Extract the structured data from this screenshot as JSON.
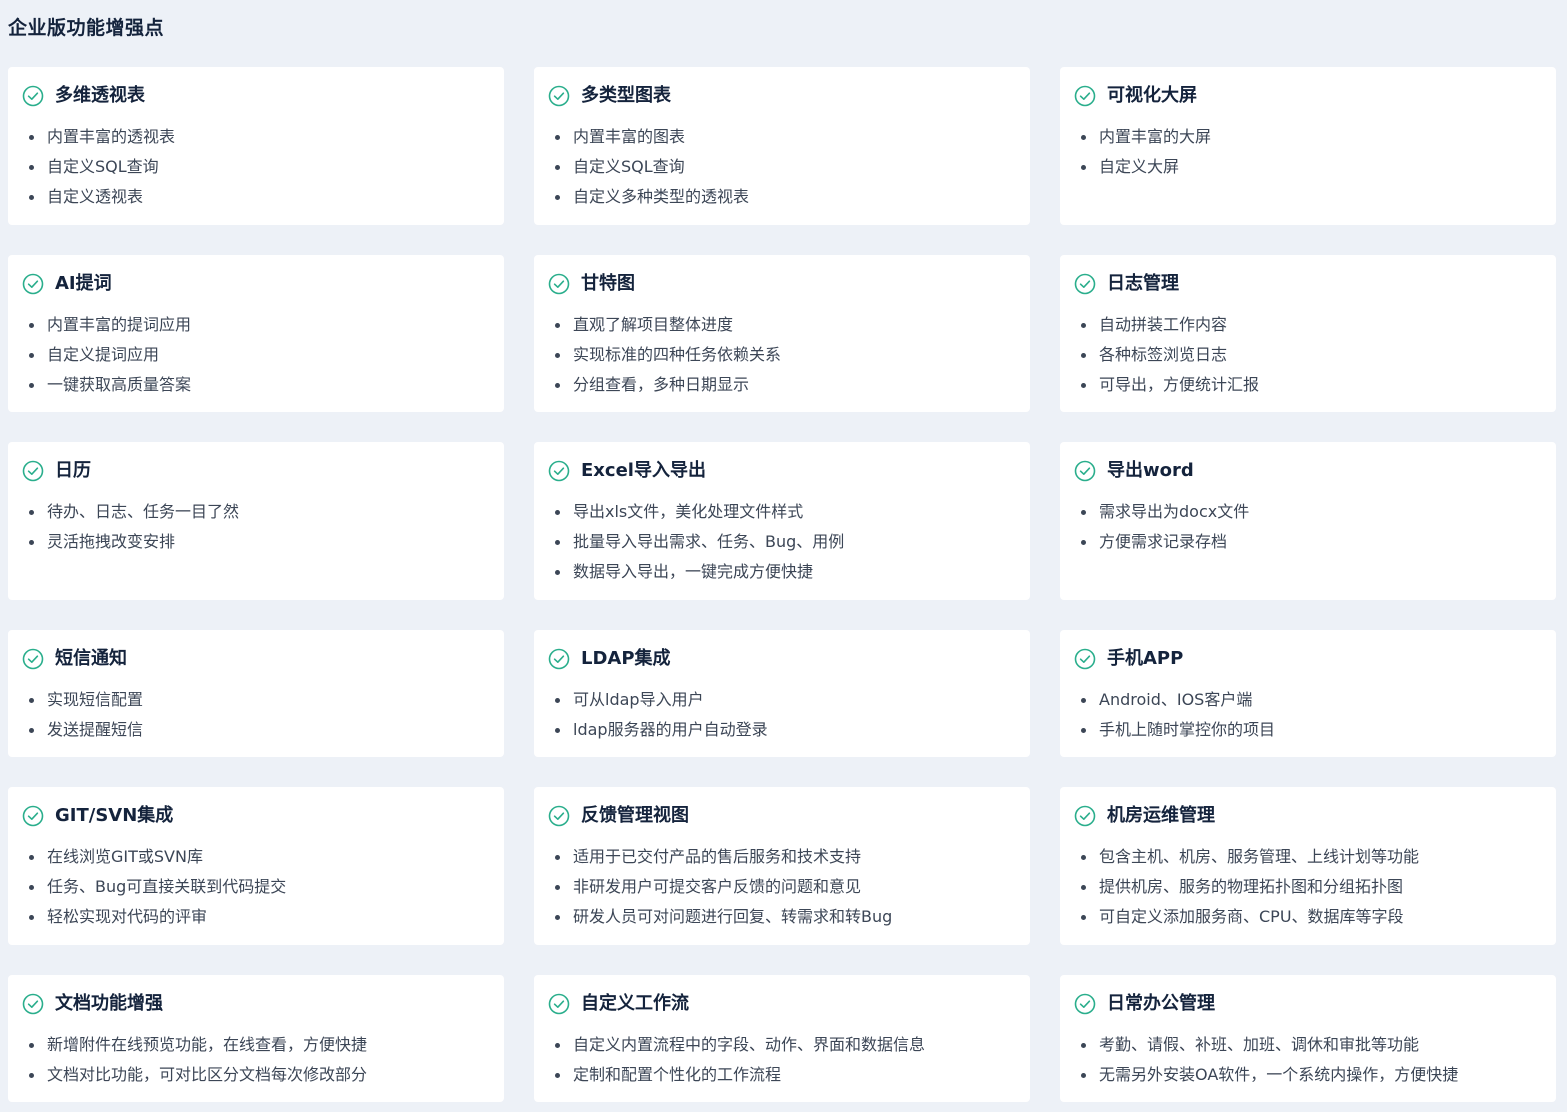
{
  "page_title": "企业版功能增强点",
  "accent_color": "#2aae8c",
  "cards": [
    {
      "title": "多维透视表",
      "icon": "check-circle-icon",
      "items": [
        "内置丰富的透视表",
        "自定义SQL查询",
        "自定义透视表"
      ]
    },
    {
      "title": "多类型图表",
      "icon": "check-circle-icon",
      "items": [
        "内置丰富的图表",
        "自定义SQL查询",
        "自定义多种类型的透视表"
      ]
    },
    {
      "title": "可视化大屏",
      "icon": "check-circle-icon",
      "items": [
        "内置丰富的大屏",
        "自定义大屏"
      ]
    },
    {
      "title": "AI提词",
      "icon": "check-circle-icon",
      "items": [
        "内置丰富的提词应用",
        "自定义提词应用",
        "一键获取高质量答案"
      ]
    },
    {
      "title": "甘特图",
      "icon": "check-circle-icon",
      "items": [
        "直观了解项目整体进度",
        "实现标准的四种任务依赖关系",
        "分组查看，多种日期显示"
      ]
    },
    {
      "title": "日志管理",
      "icon": "check-circle-icon",
      "items": [
        "自动拼装工作内容",
        "各种标签浏览日志",
        "可导出，方便统计汇报"
      ]
    },
    {
      "title": "日历",
      "icon": "check-circle-icon",
      "items": [
        "待办、日志、任务一目了然",
        "灵活拖拽改变安排"
      ]
    },
    {
      "title": "Excel导入导出",
      "icon": "check-circle-icon",
      "items": [
        "导出xls文件，美化处理文件样式",
        "批量导入导出需求、任务、Bug、用例",
        "数据导入导出，一键完成方便快捷"
      ]
    },
    {
      "title": "导出word",
      "icon": "check-circle-icon",
      "items": [
        "需求导出为docx文件",
        "方便需求记录存档"
      ]
    },
    {
      "title": "短信通知",
      "icon": "check-circle-icon",
      "items": [
        "实现短信配置",
        "发送提醒短信"
      ]
    },
    {
      "title": "LDAP集成",
      "icon": "check-circle-icon",
      "items": [
        "可从ldap导入用户",
        "ldap服务器的用户自动登录"
      ]
    },
    {
      "title": "手机APP",
      "icon": "check-circle-icon",
      "items": [
        "Android、IOS客户端",
        "手机上随时掌控你的项目"
      ]
    },
    {
      "title": "GIT/SVN集成",
      "icon": "check-circle-icon",
      "items": [
        "在线浏览GIT或SVN库",
        "任务、Bug可直接关联到代码提交",
        "轻松实现对代码的评审"
      ]
    },
    {
      "title": "反馈管理视图",
      "icon": "check-circle-icon",
      "items": [
        "适用于已交付产品的售后服务和技术支持",
        "非研发用户可提交客户反馈的问题和意见",
        "研发人员可对问题进行回复、转需求和转Bug"
      ]
    },
    {
      "title": "机房运维管理",
      "icon": "check-circle-icon",
      "items": [
        "包含主机、机房、服务管理、上线计划等功能",
        "提供机房、服务的物理拓扑图和分组拓扑图",
        "可自定义添加服务商、CPU、数据库等字段"
      ]
    },
    {
      "title": "文档功能增强",
      "icon": "check-circle-icon",
      "items": [
        "新增附件在线预览功能，在线查看，方便快捷",
        "文档对比功能，可对比区分文档每次修改部分"
      ]
    },
    {
      "title": "自定义工作流",
      "icon": "check-circle-icon",
      "items": [
        "自定义内置流程中的字段、动作、界面和数据信息",
        "定制和配置个性化的工作流程"
      ]
    },
    {
      "title": "日常办公管理",
      "icon": "check-circle-icon",
      "items": [
        "考勤、请假、补班、加班、调休和审批等功能",
        "无需另外安装OA软件，一个系统内操作，方便快捷"
      ]
    }
  ]
}
